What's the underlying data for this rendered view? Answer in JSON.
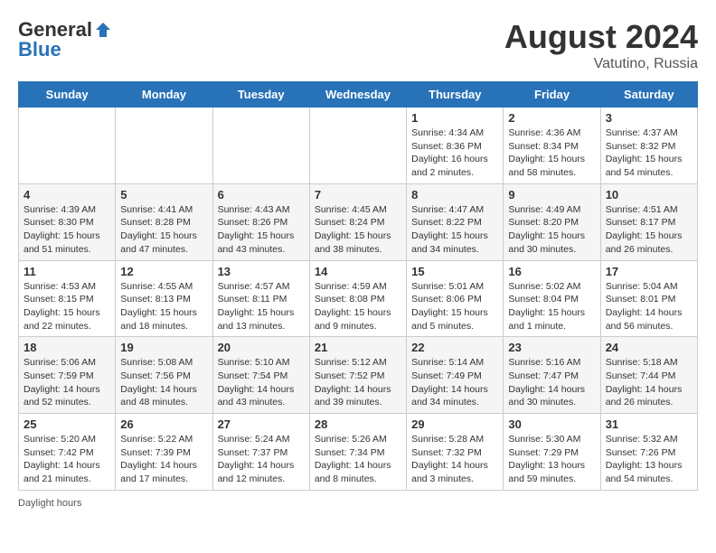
{
  "header": {
    "logo_line1": "General",
    "logo_line2": "Blue",
    "main_title": "August 2024",
    "subtitle": "Vatutino, Russia"
  },
  "days_of_week": [
    "Sunday",
    "Monday",
    "Tuesday",
    "Wednesday",
    "Thursday",
    "Friday",
    "Saturday"
  ],
  "weeks": [
    [
      {
        "day": "",
        "info": ""
      },
      {
        "day": "",
        "info": ""
      },
      {
        "day": "",
        "info": ""
      },
      {
        "day": "",
        "info": ""
      },
      {
        "day": "1",
        "info": "Sunrise: 4:34 AM\nSunset: 8:36 PM\nDaylight: 16 hours\nand 2 minutes."
      },
      {
        "day": "2",
        "info": "Sunrise: 4:36 AM\nSunset: 8:34 PM\nDaylight: 15 hours\nand 58 minutes."
      },
      {
        "day": "3",
        "info": "Sunrise: 4:37 AM\nSunset: 8:32 PM\nDaylight: 15 hours\nand 54 minutes."
      }
    ],
    [
      {
        "day": "4",
        "info": "Sunrise: 4:39 AM\nSunset: 8:30 PM\nDaylight: 15 hours\nand 51 minutes."
      },
      {
        "day": "5",
        "info": "Sunrise: 4:41 AM\nSunset: 8:28 PM\nDaylight: 15 hours\nand 47 minutes."
      },
      {
        "day": "6",
        "info": "Sunrise: 4:43 AM\nSunset: 8:26 PM\nDaylight: 15 hours\nand 43 minutes."
      },
      {
        "day": "7",
        "info": "Sunrise: 4:45 AM\nSunset: 8:24 PM\nDaylight: 15 hours\nand 38 minutes."
      },
      {
        "day": "8",
        "info": "Sunrise: 4:47 AM\nSunset: 8:22 PM\nDaylight: 15 hours\nand 34 minutes."
      },
      {
        "day": "9",
        "info": "Sunrise: 4:49 AM\nSunset: 8:20 PM\nDaylight: 15 hours\nand 30 minutes."
      },
      {
        "day": "10",
        "info": "Sunrise: 4:51 AM\nSunset: 8:17 PM\nDaylight: 15 hours\nand 26 minutes."
      }
    ],
    [
      {
        "day": "11",
        "info": "Sunrise: 4:53 AM\nSunset: 8:15 PM\nDaylight: 15 hours\nand 22 minutes."
      },
      {
        "day": "12",
        "info": "Sunrise: 4:55 AM\nSunset: 8:13 PM\nDaylight: 15 hours\nand 18 minutes."
      },
      {
        "day": "13",
        "info": "Sunrise: 4:57 AM\nSunset: 8:11 PM\nDaylight: 15 hours\nand 13 minutes."
      },
      {
        "day": "14",
        "info": "Sunrise: 4:59 AM\nSunset: 8:08 PM\nDaylight: 15 hours\nand 9 minutes."
      },
      {
        "day": "15",
        "info": "Sunrise: 5:01 AM\nSunset: 8:06 PM\nDaylight: 15 hours\nand 5 minutes."
      },
      {
        "day": "16",
        "info": "Sunrise: 5:02 AM\nSunset: 8:04 PM\nDaylight: 15 hours\nand 1 minute."
      },
      {
        "day": "17",
        "info": "Sunrise: 5:04 AM\nSunset: 8:01 PM\nDaylight: 14 hours\nand 56 minutes."
      }
    ],
    [
      {
        "day": "18",
        "info": "Sunrise: 5:06 AM\nSunset: 7:59 PM\nDaylight: 14 hours\nand 52 minutes."
      },
      {
        "day": "19",
        "info": "Sunrise: 5:08 AM\nSunset: 7:56 PM\nDaylight: 14 hours\nand 48 minutes."
      },
      {
        "day": "20",
        "info": "Sunrise: 5:10 AM\nSunset: 7:54 PM\nDaylight: 14 hours\nand 43 minutes."
      },
      {
        "day": "21",
        "info": "Sunrise: 5:12 AM\nSunset: 7:52 PM\nDaylight: 14 hours\nand 39 minutes."
      },
      {
        "day": "22",
        "info": "Sunrise: 5:14 AM\nSunset: 7:49 PM\nDaylight: 14 hours\nand 34 minutes."
      },
      {
        "day": "23",
        "info": "Sunrise: 5:16 AM\nSunset: 7:47 PM\nDaylight: 14 hours\nand 30 minutes."
      },
      {
        "day": "24",
        "info": "Sunrise: 5:18 AM\nSunset: 7:44 PM\nDaylight: 14 hours\nand 26 minutes."
      }
    ],
    [
      {
        "day": "25",
        "info": "Sunrise: 5:20 AM\nSunset: 7:42 PM\nDaylight: 14 hours\nand 21 minutes."
      },
      {
        "day": "26",
        "info": "Sunrise: 5:22 AM\nSunset: 7:39 PM\nDaylight: 14 hours\nand 17 minutes."
      },
      {
        "day": "27",
        "info": "Sunrise: 5:24 AM\nSunset: 7:37 PM\nDaylight: 14 hours\nand 12 minutes."
      },
      {
        "day": "28",
        "info": "Sunrise: 5:26 AM\nSunset: 7:34 PM\nDaylight: 14 hours\nand 8 minutes."
      },
      {
        "day": "29",
        "info": "Sunrise: 5:28 AM\nSunset: 7:32 PM\nDaylight: 14 hours\nand 3 minutes."
      },
      {
        "day": "30",
        "info": "Sunrise: 5:30 AM\nSunset: 7:29 PM\nDaylight: 13 hours\nand 59 minutes."
      },
      {
        "day": "31",
        "info": "Sunrise: 5:32 AM\nSunset: 7:26 PM\nDaylight: 13 hours\nand 54 minutes."
      }
    ]
  ],
  "footer": {
    "note": "Daylight hours"
  }
}
